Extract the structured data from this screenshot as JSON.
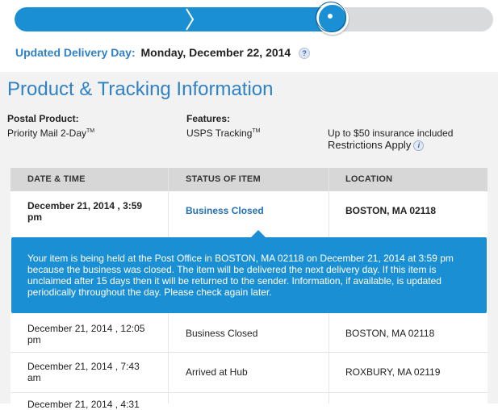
{
  "progress": {
    "fraction": 0.66
  },
  "delivery": {
    "label": "Updated Delivery Day:",
    "date": "Monday, December 22, 2014",
    "help_glyph": "?"
  },
  "panel": {
    "title": "Product & Tracking Information",
    "postal_product_label": "Postal Product:",
    "postal_product_value": "Priority Mail 2-Day",
    "postal_product_tm": "TM",
    "features_label": "Features:",
    "features_value": "USPS Tracking",
    "features_tm": "TM",
    "insurance_text": "Up to $50 insurance included",
    "restrictions_text": "Restrictions Apply",
    "info_glyph": "i"
  },
  "table": {
    "headers": [
      "DATE & TIME",
      "STATUS OF ITEM",
      "LOCATION"
    ],
    "rows": [
      {
        "date_line1": "December 21, 2014 , 3:59",
        "date_line2": "pm",
        "status": "Business Closed",
        "location": "BOSTON, MA 02118"
      },
      {
        "date_line1": "December 21, 2014 , 12:05",
        "date_line2": "pm",
        "status": "Business Closed",
        "location": "BOSTON, MA 02118"
      },
      {
        "date_line1": "December 21, 2014 , 7:43",
        "date_line2": "am",
        "status": "Arrived at Hub",
        "location": "ROXBURY, MA 02119"
      },
      {
        "date_line1": "December 21, 2014 , 4:31",
        "date_line2": "",
        "status": "",
        "location": ""
      }
    ]
  },
  "callout": {
    "text": "Your item is being held at the Post Office in BOSTON, MA 02118 on December 21, 2014 at 3:59 pm because the business was closed. The item will be delivered the next delivery day. If this item is unclaimed after 15 days then it will be returned to the sender. Information, if available, is updated periodically throughout the day. Please check again later."
  },
  "colors": {
    "accent": "#1b8fd3",
    "title_blue": "#3081c6",
    "link_blue": "#2170b8"
  }
}
